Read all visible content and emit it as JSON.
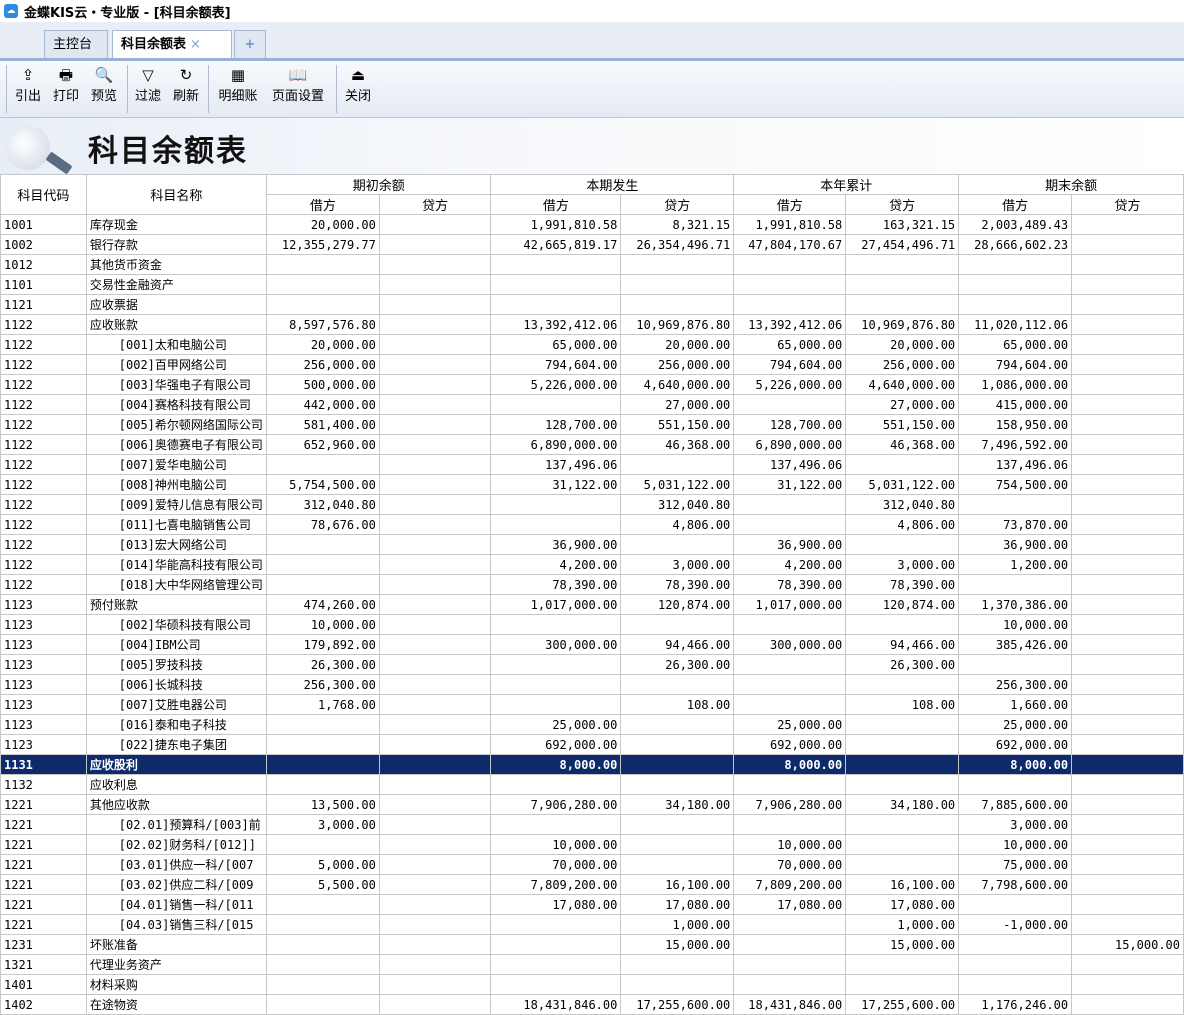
{
  "app": {
    "title": "金蝶KIS云・专业版 - [科目余额表]",
    "icon": "app-logo-icon"
  },
  "tabs": [
    {
      "label": "主控台",
      "active": false
    },
    {
      "label": "科目余额表",
      "active": true,
      "close": "×"
    },
    {
      "label": "+",
      "icon": "add-tab-icon"
    }
  ],
  "toolbar": [
    {
      "label": "引出",
      "icon": "export-icon",
      "glyph": "⇪"
    },
    {
      "label": "打印",
      "icon": "print-icon",
      "glyph": "🖶"
    },
    {
      "label": "预览",
      "icon": "preview-icon",
      "glyph": "🔍"
    },
    {
      "label": "过滤",
      "icon": "filter-icon",
      "glyph": "▽"
    },
    {
      "label": "刷新",
      "icon": "refresh-icon",
      "glyph": "↻"
    },
    {
      "label": "明细账",
      "icon": "ledger-icon",
      "glyph": "▦"
    },
    {
      "label": "页面设置",
      "icon": "page-setup-icon",
      "glyph": "📖"
    },
    {
      "label": "关闭",
      "icon": "close-door-icon",
      "glyph": "⏏"
    }
  ],
  "report": {
    "title": "科目余额表"
  },
  "headers": {
    "code": "科目代码",
    "name": "科目名称",
    "groups": [
      "期初余额",
      "本期发生",
      "本年累计",
      "期末余额"
    ],
    "debit": "借方",
    "credit": "贷方"
  },
  "rows": [
    [
      "1001",
      "库存现金",
      "20,000.00",
      "",
      "1,991,810.58",
      "8,321.15",
      "1,991,810.58",
      "163,321.15",
      "2,003,489.43",
      ""
    ],
    [
      "1002",
      "银行存款",
      "12,355,279.77",
      "",
      "42,665,819.17",
      "26,354,496.71",
      "47,804,170.67",
      "27,454,496.71",
      "28,666,602.23",
      ""
    ],
    [
      "1012",
      "其他货币资金",
      "",
      "",
      "",
      "",
      "",
      "",
      "",
      ""
    ],
    [
      "1101",
      "交易性金融资产",
      "",
      "",
      "",
      "",
      "",
      "",
      "",
      ""
    ],
    [
      "1121",
      "应收票据",
      "",
      "",
      "",
      "",
      "",
      "",
      "",
      ""
    ],
    [
      "1122",
      "应收账款",
      "8,597,576.80",
      "",
      "13,392,412.06",
      "10,969,876.80",
      "13,392,412.06",
      "10,969,876.80",
      "11,020,112.06",
      ""
    ],
    [
      "1122",
      "    [001]太和电脑公司",
      "20,000.00",
      "",
      "65,000.00",
      "20,000.00",
      "65,000.00",
      "20,000.00",
      "65,000.00",
      ""
    ],
    [
      "1122",
      "    [002]百甲网络公司",
      "256,000.00",
      "",
      "794,604.00",
      "256,000.00",
      "794,604.00",
      "256,000.00",
      "794,604.00",
      ""
    ],
    [
      "1122",
      "    [003]华强电子有限公司",
      "500,000.00",
      "",
      "5,226,000.00",
      "4,640,000.00",
      "5,226,000.00",
      "4,640,000.00",
      "1,086,000.00",
      ""
    ],
    [
      "1122",
      "    [004]赛格科技有限公司",
      "442,000.00",
      "",
      "",
      "27,000.00",
      "",
      "27,000.00",
      "415,000.00",
      ""
    ],
    [
      "1122",
      "    [005]希尔顿网络国际公司",
      "581,400.00",
      "",
      "128,700.00",
      "551,150.00",
      "128,700.00",
      "551,150.00",
      "158,950.00",
      ""
    ],
    [
      "1122",
      "    [006]奥德赛电子有限公司",
      "652,960.00",
      "",
      "6,890,000.00",
      "46,368.00",
      "6,890,000.00",
      "46,368.00",
      "7,496,592.00",
      ""
    ],
    [
      "1122",
      "    [007]爱华电脑公司",
      "",
      "",
      "137,496.06",
      "",
      "137,496.06",
      "",
      "137,496.06",
      ""
    ],
    [
      "1122",
      "    [008]神州电脑公司",
      "5,754,500.00",
      "",
      "31,122.00",
      "5,031,122.00",
      "31,122.00",
      "5,031,122.00",
      "754,500.00",
      ""
    ],
    [
      "1122",
      "    [009]爱特儿信息有限公司",
      "312,040.80",
      "",
      "",
      "312,040.80",
      "",
      "312,040.80",
      "",
      ""
    ],
    [
      "1122",
      "    [011]七喜电脑销售公司",
      "78,676.00",
      "",
      "",
      "4,806.00",
      "",
      "4,806.00",
      "73,870.00",
      ""
    ],
    [
      "1122",
      "    [013]宏大网络公司",
      "",
      "",
      "36,900.00",
      "",
      "36,900.00",
      "",
      "36,900.00",
      ""
    ],
    [
      "1122",
      "    [014]华能高科技有限公司",
      "",
      "",
      "4,200.00",
      "3,000.00",
      "4,200.00",
      "3,000.00",
      "1,200.00",
      ""
    ],
    [
      "1122",
      "    [018]大中华网络管理公司",
      "",
      "",
      "78,390.00",
      "78,390.00",
      "78,390.00",
      "78,390.00",
      "",
      ""
    ],
    [
      "1123",
      "预付账款",
      "474,260.00",
      "",
      "1,017,000.00",
      "120,874.00",
      "1,017,000.00",
      "120,874.00",
      "1,370,386.00",
      ""
    ],
    [
      "1123",
      "    [002]华硕科技有限公司",
      "10,000.00",
      "",
      "",
      "",
      "",
      "",
      "10,000.00",
      ""
    ],
    [
      "1123",
      "    [004]IBM公司",
      "179,892.00",
      "",
      "300,000.00",
      "94,466.00",
      "300,000.00",
      "94,466.00",
      "385,426.00",
      ""
    ],
    [
      "1123",
      "    [005]罗技科技",
      "26,300.00",
      "",
      "",
      "26,300.00",
      "",
      "26,300.00",
      "",
      ""
    ],
    [
      "1123",
      "    [006]长城科技",
      "256,300.00",
      "",
      "",
      "",
      "",
      "",
      "256,300.00",
      ""
    ],
    [
      "1123",
      "    [007]艾胜电器公司",
      "1,768.00",
      "",
      "",
      "108.00",
      "",
      "108.00",
      "1,660.00",
      ""
    ],
    [
      "1123",
      "    [016]泰和电子科技",
      "",
      "",
      "25,000.00",
      "",
      "25,000.00",
      "",
      "25,000.00",
      ""
    ],
    [
      "1123",
      "    [022]捷东电子集团",
      "",
      "",
      "692,000.00",
      "",
      "692,000.00",
      "",
      "692,000.00",
      ""
    ],
    [
      "1131",
      "应收股利",
      "",
      "",
      "8,000.00",
      "",
      "8,000.00",
      "",
      "8,000.00",
      ""
    ],
    [
      "1132",
      "应收利息",
      "",
      "",
      "",
      "",
      "",
      "",
      "",
      ""
    ],
    [
      "1221",
      "其他应收款",
      "13,500.00",
      "",
      "7,906,280.00",
      "34,180.00",
      "7,906,280.00",
      "34,180.00",
      "7,885,600.00",
      ""
    ],
    [
      "1221",
      "    [02.01]预算科/[003]前",
      "3,000.00",
      "",
      "",
      "",
      "",
      "",
      "3,000.00",
      ""
    ],
    [
      "1221",
      "    [02.02]财务科/[012]]",
      "",
      "",
      "10,000.00",
      "",
      "10,000.00",
      "",
      "10,000.00",
      ""
    ],
    [
      "1221",
      "    [03.01]供应一科/[007",
      "5,000.00",
      "",
      "70,000.00",
      "",
      "70,000.00",
      "",
      "75,000.00",
      ""
    ],
    [
      "1221",
      "    [03.02]供应二科/[009",
      "5,500.00",
      "",
      "7,809,200.00",
      "16,100.00",
      "7,809,200.00",
      "16,100.00",
      "7,798,600.00",
      ""
    ],
    [
      "1221",
      "    [04.01]销售一科/[011",
      "",
      "",
      "17,080.00",
      "17,080.00",
      "17,080.00",
      "17,080.00",
      "",
      ""
    ],
    [
      "1221",
      "    [04.03]销售三科/[015",
      "",
      "",
      "",
      "1,000.00",
      "",
      "1,000.00",
      "-1,000.00",
      ""
    ],
    [
      "1231",
      "坏账准备",
      "",
      "",
      "",
      "15,000.00",
      "",
      "15,000.00",
      "",
      "15,000.00"
    ],
    [
      "1321",
      "代理业务资产",
      "",
      "",
      "",
      "",
      "",
      "",
      "",
      ""
    ],
    [
      "1401",
      "材料采购",
      "",
      "",
      "",
      "",
      "",
      "",
      "",
      ""
    ],
    [
      "1402",
      "在途物资",
      "",
      "",
      "18,431,846.00",
      "17,255,600.00",
      "18,431,846.00",
      "17,255,600.00",
      "1,176,246.00",
      ""
    ]
  ],
  "selected_row": 27
}
